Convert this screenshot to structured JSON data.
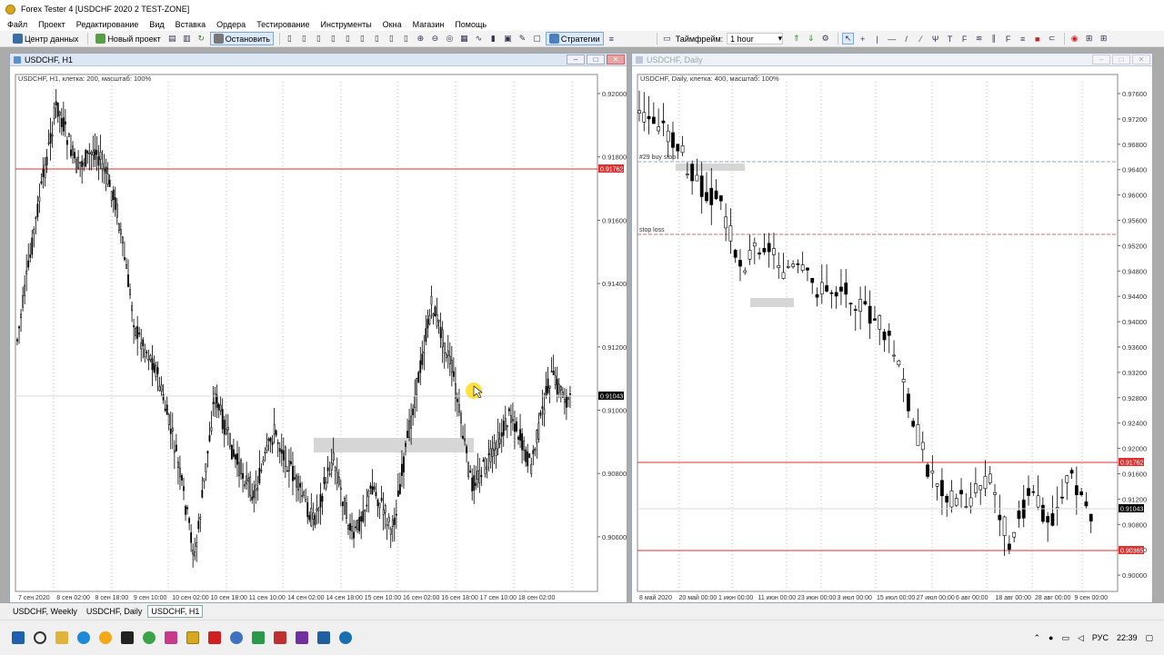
{
  "window": {
    "title": "Forex Tester 4  [USDCHF 2020 2 TEST-ZONE]"
  },
  "menu": [
    "Файл",
    "Проект",
    "Редактирование",
    "Вид",
    "Вставка",
    "Ордера",
    "Тестирование",
    "Инструменты",
    "Окна",
    "Магазин",
    "Помощь"
  ],
  "toolbar": {
    "data_center": "Центр данных",
    "new_project": "Новый проект",
    "stop": "Остановить",
    "strategies": "Стратегии",
    "timeframe_label": "Таймфрейм:",
    "timeframe_value": "1 hour"
  },
  "chart_h1": {
    "window_title": "USDCHF, H1",
    "info": "USDCHF, H1, клетка: 200, масштаб: 100%",
    "y_ticks": [
      "0.92000",
      "0.91800",
      "0.91600",
      "0.91400",
      "0.91200",
      "0.91000",
      "0.90800",
      "0.90600"
    ],
    "x_labels": [
      "7 сен 2020",
      "8 сен 02:00",
      "8 сен 18:00",
      "9 сен 10:00",
      "10 сен 02:00",
      "10 сен 18:00",
      "11 сен 10:00",
      "14 сен 02:00",
      "14 сен 18:00",
      "15 сен 10:00",
      "16 сен 02:00",
      "16 сен 18:00",
      "17 сен 10:00",
      "18 сен 02:00"
    ],
    "red_level": "0.91762",
    "current_price": "0.91043"
  },
  "chart_daily": {
    "window_title": "USDCHF, Daily",
    "info": "USDCHF, Daily, клетка: 400, масштаб: 100%",
    "y_ticks": [
      "0.97600",
      "0.97200",
      "0.96800",
      "0.96400",
      "0.96000",
      "0.95600",
      "0.95200",
      "0.94800",
      "0.94400",
      "0.94000",
      "0.93600",
      "0.93200",
      "0.92800",
      "0.92400",
      "0.92000",
      "0.91600",
      "0.91200",
      "0.90800",
      "0.90400",
      "0.90000"
    ],
    "x_labels": [
      "8 май 2020",
      "20 май 00:00",
      "1 июн 00:00",
      "11 июн 00:00",
      "23 июн 00:00",
      "3 июл 00:00",
      "15 июл 00:00",
      "27 июл 00:00",
      "6 авг 00:00",
      "18 авг 00:00",
      "28 авг 00:00",
      "9 сен 00:00"
    ],
    "buy_stop_label": "#29 buy stop",
    "stop_loss_label": "stop loss",
    "level_top": "0.91762",
    "current_price": "0.91043",
    "level_bottom": "0.90365"
  },
  "sheet_tabs": [
    "USDCHF, Weekly",
    "USDCHF, Daily",
    "USDCHF, H1"
  ],
  "taskbar": {
    "lang": "РУС",
    "time": "22:39"
  },
  "colors": {
    "red_line": "#e03030",
    "price_box": "#000000",
    "highlight": "#cfcfcf",
    "cursor": "#ffd700"
  }
}
